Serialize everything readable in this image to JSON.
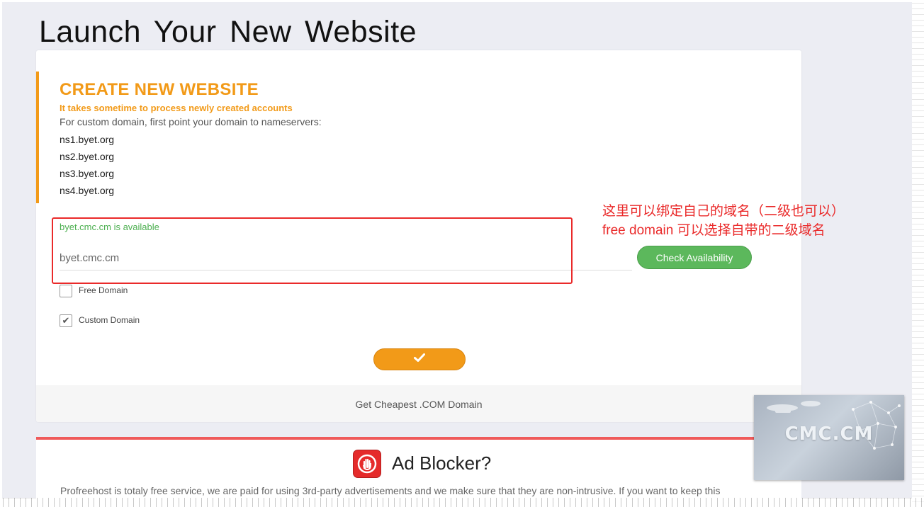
{
  "page": {
    "title": "Launch Your New Website"
  },
  "create": {
    "heading": "CREATE NEW WEBSITE",
    "warning": "It takes sometime to process newly created accounts",
    "description": "For custom domain, first point your domain to nameservers:",
    "nameservers": [
      "ns1.byet.org",
      "ns2.byet.org",
      "ns3.byet.org",
      "ns4.byet.org"
    ]
  },
  "domain": {
    "availability_message": "byet.cmc.cm is available",
    "value": "byet.cmc.cm",
    "check_button": "Check Availability",
    "options": [
      {
        "label": "Free Domain",
        "checked": false
      },
      {
        "label": "Custom Domain",
        "checked": true
      }
    ],
    "submit_icon": "checkmark-icon"
  },
  "footer": {
    "link": "Get Cheapest .COM Domain"
  },
  "adblock": {
    "title": "Ad Blocker?",
    "text": "Profreehost is totaly free service, we are paid for using 3rd-party advertisements and we make sure that they are non-intrusive. If you want to keep this",
    "icon": "stop-hand-icon"
  },
  "annotation": {
    "line1": "这里可以绑定自己的域名（二级也可以）",
    "line2": "free domain 可以选择自带的二级域名"
  },
  "watermark": {
    "text": "CMC.CM"
  },
  "colors": {
    "accent": "#f29a18",
    "success": "#5cb85c",
    "annotation": "#ea2a2a",
    "adblock": "#e52b2b"
  }
}
